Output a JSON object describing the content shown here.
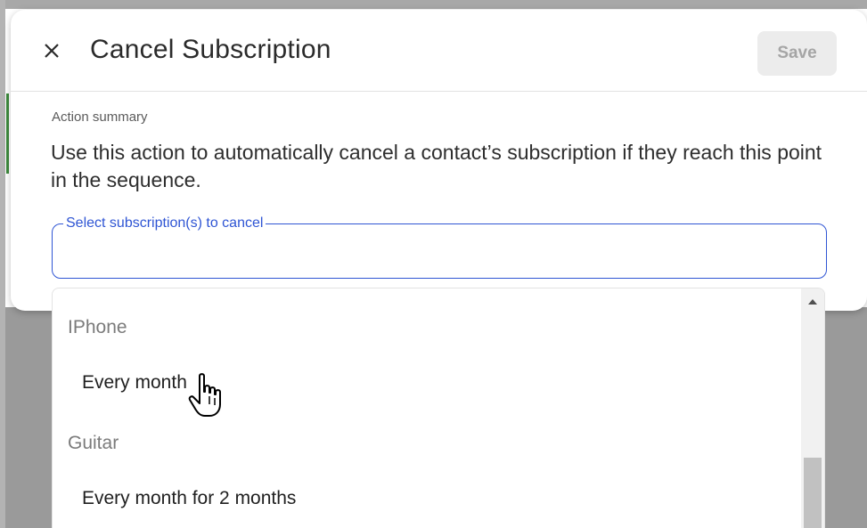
{
  "dialog": {
    "title": "Cancel Subscription",
    "close_icon": "close-icon",
    "save_label": "Save"
  },
  "summary": {
    "label": "Action summary",
    "text": "Use this action to automatically cancel a contact’s subscription if they reach this point in the sequence."
  },
  "select": {
    "label": "Select subscription(s) to cancel",
    "value": ""
  },
  "dropdown": {
    "groups": [
      {
        "label": "IPhone",
        "options": [
          "Every month"
        ]
      },
      {
        "label": "Guitar",
        "options": [
          "Every month for 2 months"
        ]
      }
    ]
  },
  "colors": {
    "accent": "#2f55d4",
    "title_text": "#2b2b2b",
    "save_bg": "#ececec",
    "save_text": "#a5a5a5"
  }
}
